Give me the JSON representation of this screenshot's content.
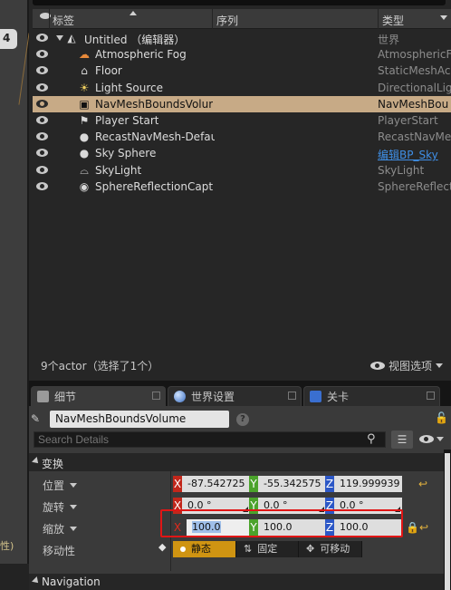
{
  "viewport": {
    "badge": "4",
    "edge_text": "性)"
  },
  "outliner": {
    "columns": {
      "label": "标签",
      "order": "序列",
      "type": "类型"
    },
    "rows": [
      {
        "name": "Untitled （编辑器）",
        "type": "世界",
        "icon": "level-icon",
        "selected": false
      },
      {
        "name": "Atmospheric Fog",
        "type": "AtmosphericF",
        "icon": "fog-icon",
        "selected": false
      },
      {
        "name": "Floor",
        "type": "StaticMeshAc",
        "icon": "static-mesh-icon",
        "selected": false
      },
      {
        "name": "Light Source",
        "type": "DirectionalLig",
        "icon": "directional-light-icon",
        "selected": false
      },
      {
        "name": "NavMeshBoundsVolume",
        "type": "NavMeshBou",
        "icon": "volume-icon",
        "selected": true
      },
      {
        "name": "Player Start",
        "type": "PlayerStart",
        "icon": "flag-icon",
        "selected": false
      },
      {
        "name": "RecastNavMesh-Default",
        "type": "RecastNavMe",
        "icon": "sphere-icon",
        "selected": false
      },
      {
        "name": "Sky Sphere",
        "type": "编辑BP_Sky",
        "icon": "sphere-icon",
        "selected": false
      },
      {
        "name": "SkyLight",
        "type": "SkyLight",
        "icon": "skylight-icon",
        "selected": false
      },
      {
        "name": "SphereReflectionCapture",
        "type": "SphereReflect",
        "icon": "sphere-capture-icon",
        "selected": false
      }
    ],
    "status": "9个actor（选择了1个）",
    "view_options": "视图选项"
  },
  "tabs": [
    {
      "label": "细节",
      "icon": "details-icon",
      "active": true
    },
    {
      "label": "世界设置",
      "icon": "globe-icon",
      "active": false
    },
    {
      "label": "关卡",
      "icon": "levels-icon",
      "active": false
    }
  ],
  "details": {
    "actor_name": "NavMeshBoundsVolume",
    "search_placeholder": "Search Details",
    "transform_section": "变换",
    "location": {
      "label": "位置",
      "x": "-87.542725",
      "y": "-55.342575",
      "z": "119.999939"
    },
    "rotation": {
      "label": "旋转",
      "x": "0.0 °",
      "y": "0.0 °",
      "z": "0.0 °"
    },
    "scale": {
      "label": "缩放",
      "x": "100.0",
      "y": "100.0",
      "z": "100.0"
    },
    "axis_labels": {
      "x": "X",
      "y": "Y",
      "z": "Z"
    },
    "mobility": {
      "label": "移动性",
      "options": [
        "静态",
        "固定",
        "可移动"
      ],
      "selected": "静态"
    },
    "navigation_section": "Navigation"
  },
  "colors": {
    "selection": "#c7aa86",
    "axis_x": "#c2271b",
    "axis_y": "#4ba32b",
    "axis_z": "#2c57c6",
    "mobility_active": "#cf9412",
    "highlight": "#e11515"
  }
}
